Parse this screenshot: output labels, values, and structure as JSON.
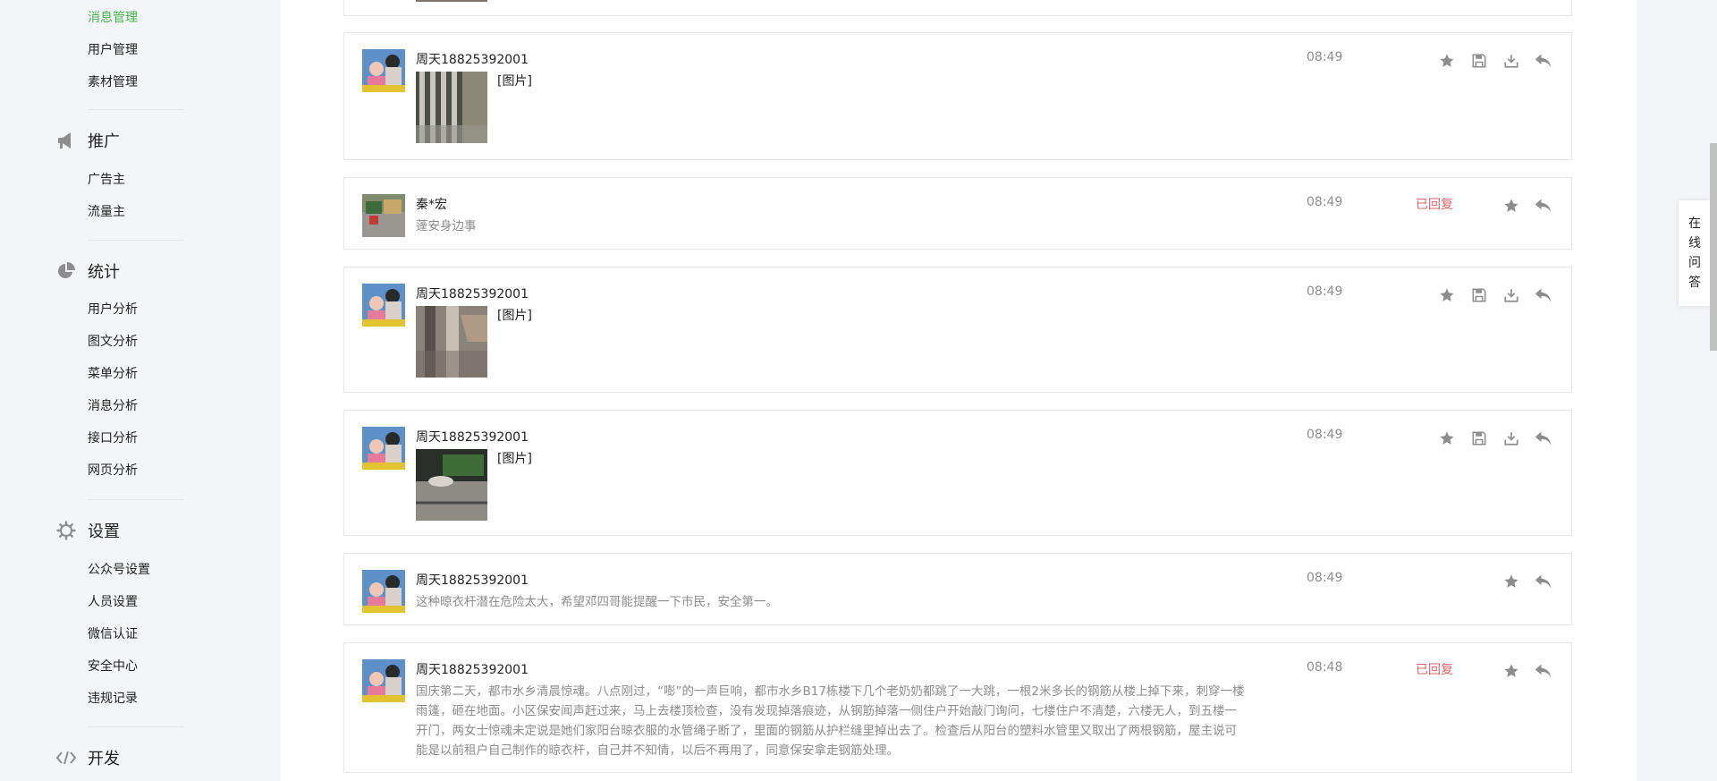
{
  "sidebar": {
    "top_items": [
      "消息管理",
      "用户管理",
      "素材管理"
    ],
    "groups": [
      {
        "icon": "megaphone-icon",
        "label": "推广",
        "items": [
          "广告主",
          "流量主"
        ]
      },
      {
        "icon": "pie-chart-icon",
        "label": "统计",
        "items": [
          "用户分析",
          "图文分析",
          "菜单分析",
          "消息分析",
          "接口分析",
          "网页分析"
        ]
      },
      {
        "icon": "gear-icon",
        "label": "设置",
        "items": [
          "公众号设置",
          "人员设置",
          "微信认证",
          "安全中心",
          "违规记录"
        ]
      },
      {
        "icon": "code-icon",
        "label": "开发",
        "items": []
      }
    ]
  },
  "messages": [
    {
      "sender": "周天18825392001",
      "time": "08:49",
      "status": "",
      "image_label": "[图片]"
    },
    {
      "sender": "秦*宏",
      "time": "08:49",
      "status": "已回复",
      "text": "蓬安身边事"
    },
    {
      "sender": "周天18825392001",
      "time": "08:49",
      "status": "",
      "image_label": "[图片]"
    },
    {
      "sender": "周天18825392001",
      "time": "08:49",
      "status": "",
      "image_label": "[图片]"
    },
    {
      "sender": "周天18825392001",
      "time": "08:49",
      "status": "",
      "text": "这种晾衣杆潜在危险太大，希望邓四哥能提醒一下市民，安全第一。"
    },
    {
      "sender": "周天18825392001",
      "time": "08:48",
      "status": "已回复",
      "text": "国庆第二天，都市水乡清晨惊魂。八点刚过，“嘭”的一声巨响，都市水乡B17栋楼下几个老奶奶都跳了一大跳，一根2米多长的钢筋从楼上掉下来，刺穿一楼雨篷，砸在地面。小区保安闻声赶过来，马上去楼顶检查，没有发现掉落痕迹，从钢筋掉落一侧住户开始敲门询问，七楼住户不清楚，六楼无人，到五楼一开门，两女士惊魂未定说是她们家阳台晾衣服的水管绳子断了，里面的钢筋从护栏缝里掉出去了。检查后从阳台的塑料水管里又取出了两根钢筋，屋主说可能是以前租户自己制作的晾衣杆，自己并不知情，以后不再用了，同意保安拿走钢筋处理。"
    }
  ],
  "float_tab": {
    "chars": [
      "在",
      "线",
      "问",
      "答"
    ]
  },
  "colors": {
    "accent": "#44b549",
    "replied": "#e15f63",
    "muted": "#8d8d8d"
  }
}
